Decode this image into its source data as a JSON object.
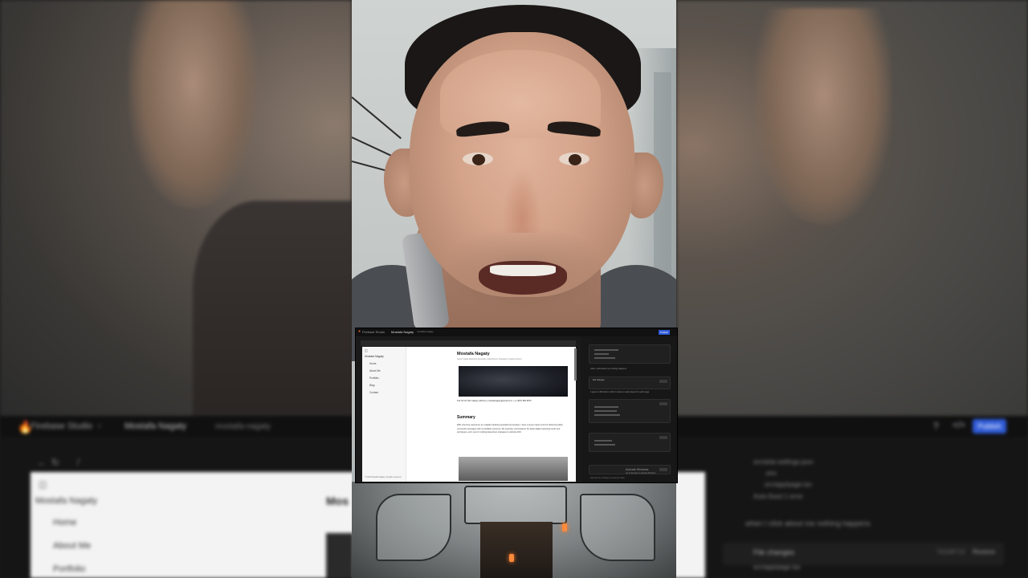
{
  "background_ui": {
    "breadcrumb_app": "Firebase Studio",
    "breadcrumb_project": "Mostafa Nagaty",
    "branch_chip": "mostafa-nagaty",
    "publish_label": "Publish",
    "path": "/",
    "site_title": "Mostafa Nagaty",
    "nav": [
      "Home",
      "About Me",
      "Portfolio"
    ],
    "page_heading_partial": "Mos",
    "chat_items": [
      "src/ai/ai-settings.json",
      ".env",
      "src/app/page.tsx",
      "Auto-fixed 1 error"
    ],
    "chat_message": "when I click about me nothing happens",
    "file_changes_label": "File changes",
    "commit_hash": "7b2d9714",
    "restore_label": "Restore",
    "file_changed": "src/app/page.tsx"
  },
  "inset": {
    "app_name": "Firebase Studio",
    "project_name": "Mostafa Nagaty",
    "branch": "mostafa-nagaty",
    "publish_label": "Publish",
    "sidebar_title": "Mostafa Nagaty",
    "nav": [
      "Home",
      "About Me",
      "Portfolio",
      "Blog",
      "Contact"
    ],
    "footer": "© 2024 Mostafa Nagaty. All rights reserved.",
    "profile_name": "Mostafa Nagaty",
    "profile_subtitle": "Senior Digital Marketing Specialist | Data-Driven Strategist | Analytics Expert",
    "contact_line": "612 SF AV SW Calgary Alberta | mostafanagaty@gmail.com | +1 (587) 882 9875",
    "summary_heading": "Summary",
    "summary_text": "With extensive experience as a digital marketing specialist and analyst, I have a proven track record of delivering highly successful campaigns with remarkable outcomes. My expertise encompasses the latest digital marketing trends and techniques, and I excel in crafting data-driven strategies to optimize ROI.",
    "chat_message_1": "when I click about me nothing happens",
    "chat_message_2": "it goes to 404 when I click it create a ready layout for each page",
    "file_changes_label": "File changes",
    "restore_label": "Restore",
    "activate_windows": "Activate Windows",
    "activate_windows_sub": "Go to Settings to activate Windows.",
    "input_placeholder": "Describe the changes you want to make..."
  },
  "colors": {
    "firebase_orange": "#e05a2b",
    "publish_blue": "#2f5bd8",
    "dark_bg": "#151515"
  }
}
